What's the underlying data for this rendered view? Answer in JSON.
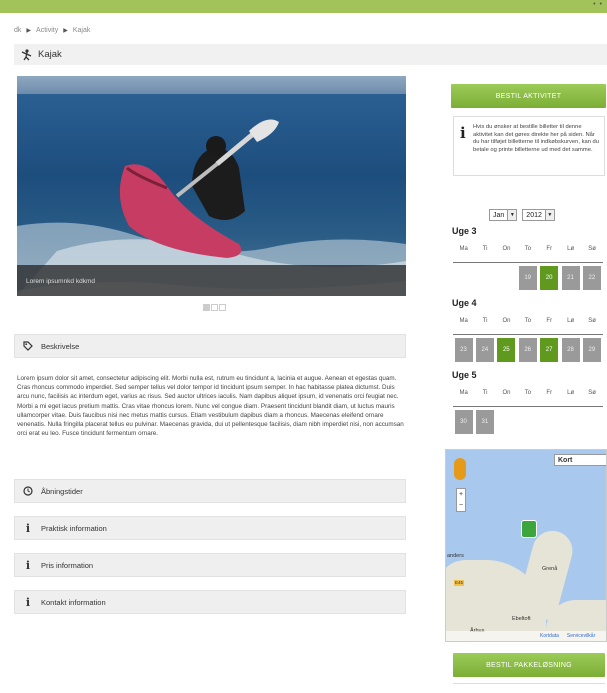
{
  "breadcrumb": {
    "items": [
      "dk",
      "Activity",
      "Kajak"
    ],
    "separator": "▶"
  },
  "page": {
    "title": "Kajak"
  },
  "hero": {
    "caption": "Lorem ipsumnkd kdkmd"
  },
  "sections": {
    "description_label": "Beskrivelse",
    "description_text": "Lorem ipsum dolor sit amet, consectetur adipiscing elit. Morbi nulla est, rutrum eu tincidunt a, lacinia et augue. Aenean et egestas quam. Cras rhoncus commodo imperdiet. Sed semper tellus vel dolor tempor id tincidunt ipsum semper. In hac habitasse platea dictumst. Duis arcu nunc, facilisis ac interdum eget, varius ac risus. Sed auctor ultrices iaculis. Nam dapibus aliquet ipsum, id venenatis orci feugiat nec. Morbi a mi eget lacus pretium mattis. Cras vitae rhoncus lorem. Nunc vel congue diam. Praesent tincidunt blandit diam, ut luctus mauris ullamcorper vitae. Duis faucibus nisi nec metus mattis cursus. Etiam vestibulum dapibus diam a rhoncus. Maecenas eleifend ornare venenatis. Nulla fringilla placerat tellus eu pulvinar. Maecenas gravida, dui ut pellentesque facilisis, diam nibh imperdiet nisi, non accumsan orci erat eu leo. Fusce tincidunt fermentum ornare.",
    "opening_label": "Åbningstider",
    "practical_label": "Praktisk information",
    "price_label": "Pris information",
    "contact_label": "Kontakt information"
  },
  "booking": {
    "button_label": "BESTIL AKTIVITET",
    "info_text": "Hvis du ønsker at bestille billetter til denne aktivitet kan det gøres direkte her på siden. Når du har tilføjet billetterne til indkøbskurven, kan du betale og printe billetterne ud med det samme.",
    "month_value": "Jan",
    "year_value": "2012",
    "day_names": [
      "Ma",
      "Ti",
      "On",
      "To",
      "Fr",
      "Lø",
      "Sø"
    ],
    "weeks": [
      {
        "title": "Uge 3",
        "days": [
          {
            "col": 3,
            "label": "19",
            "green": false
          },
          {
            "col": 4,
            "label": "20",
            "green": true
          },
          {
            "col": 5,
            "label": "21",
            "green": false
          },
          {
            "col": 6,
            "label": "22",
            "green": false
          }
        ]
      },
      {
        "title": "Uge 4",
        "days": [
          {
            "col": 0,
            "label": "23",
            "green": false
          },
          {
            "col": 1,
            "label": "24",
            "green": false
          },
          {
            "col": 2,
            "label": "25",
            "green": true
          },
          {
            "col": 3,
            "label": "26",
            "green": false
          },
          {
            "col": 4,
            "label": "27",
            "green": true
          },
          {
            "col": 5,
            "label": "28",
            "green": false
          },
          {
            "col": 6,
            "label": "29",
            "green": false
          }
        ]
      },
      {
        "title": "Uge 5",
        "days": [
          {
            "col": 0,
            "label": "30",
            "green": false
          },
          {
            "col": 1,
            "label": "31",
            "green": false
          }
        ]
      }
    ]
  },
  "map": {
    "type_select": "Kort",
    "labels": [
      "anders",
      "Grenå",
      "Ebeltoft",
      "Århus"
    ],
    "road": "E45",
    "footer_left": "Kortdata",
    "footer_right": "Servicevilkår"
  },
  "package": {
    "button_label": "BESTIL PAKKELØSNING"
  },
  "colors": {
    "green_bar": "#a2c25a",
    "button_green": "#7cae36",
    "day_green": "#5f9a1e",
    "day_gray": "#9a9a9a"
  }
}
